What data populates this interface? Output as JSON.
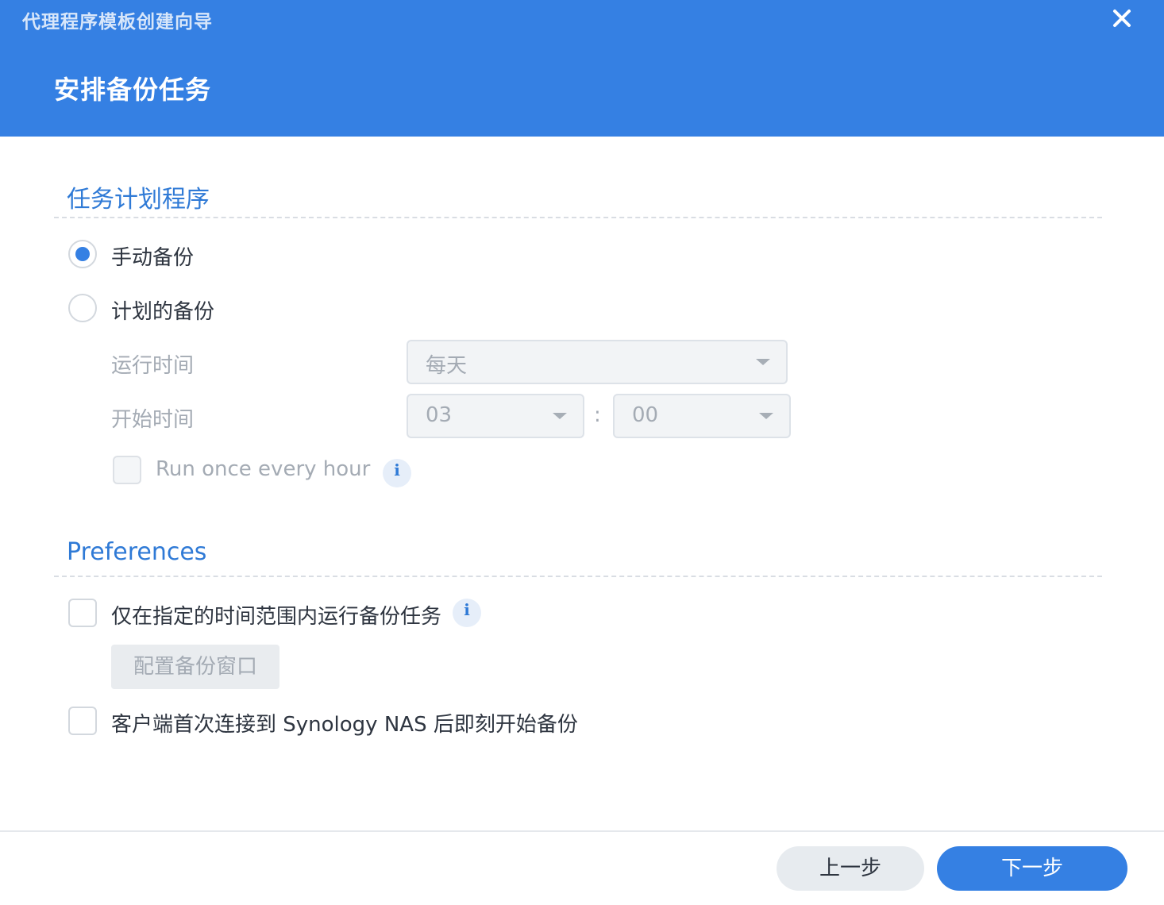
{
  "window": {
    "title": "代理程序模板创建向导",
    "close_icon": "close-icon"
  },
  "step": {
    "title": "安排备份任务"
  },
  "schedule": {
    "section_title": "任务计划程序",
    "manual_label": "手动备份",
    "manual_selected": true,
    "scheduled_label": "计划的备份",
    "scheduled_selected": false,
    "run_time_label": "运行时间",
    "run_time_value": "每天",
    "start_time_label": "开始时间",
    "start_hour": "03",
    "time_separator": ":",
    "start_minute": "00",
    "run_hourly_label": "Run once every hour",
    "run_hourly_checked": false,
    "info_icon_glyph": "i"
  },
  "preferences": {
    "section_title": "Preferences",
    "time_window_label": "仅在指定的时间范围内运行备份任务",
    "time_window_checked": false,
    "configure_window_label": "配置备份窗口",
    "first_connect_label": "客户端首次连接到 Synology NAS 后即刻开始备份",
    "first_connect_checked": false,
    "info_icon_glyph": "i"
  },
  "footer": {
    "prev_label": "上一步",
    "next_label": "下一步"
  },
  "colors": {
    "accent": "#3580e3",
    "section_title": "#2f7ad6"
  }
}
